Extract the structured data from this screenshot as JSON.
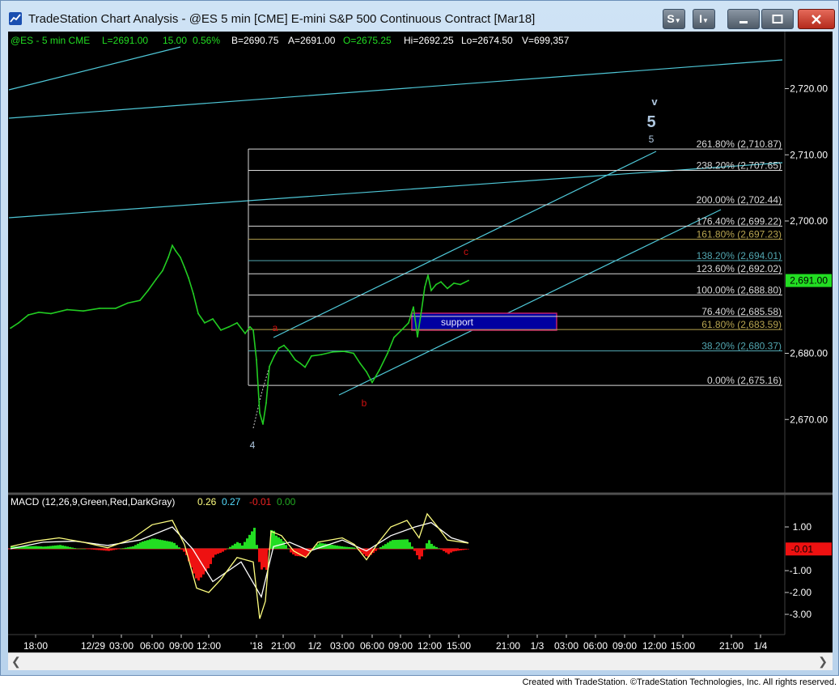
{
  "window": {
    "title": "TradeStation Chart Analysis - @ES 5 min [CME] E-mini S&P 500 Continuous Contract [Mar18]",
    "buttons": {
      "s_menu": "S",
      "i_menu": "I"
    }
  },
  "symbol_bar": {
    "symbol": "@ES - 5 min  CME",
    "last": "L=2691.00",
    "change": "15.00",
    "pct": "0.56%",
    "bid": "B=2690.75",
    "ask": "A=2691.00",
    "open": "O=2675.25",
    "high": "Hi=2692.25",
    "low": "Lo=2674.50",
    "volume": "V=699,357"
  },
  "price_axis": {
    "ticks": [
      "2,720.00",
      "2,710.00",
      "2,700.00",
      "2,680.00",
      "2,670.00"
    ],
    "tick_values": [
      2720,
      2710,
      2700,
      2680,
      2670
    ],
    "last_label": "2,691.00",
    "last_value": 2691
  },
  "fib_levels": [
    {
      "label": "261.80% (2,710.87)",
      "value": 2710.87,
      "color": "#d9d9d9"
    },
    {
      "label": "238.20% (2,707.65)",
      "value": 2707.65,
      "color": "#d9d9d9"
    },
    {
      "label": "200.00% (2,702.44)",
      "value": 2702.44,
      "color": "#d9d9d9"
    },
    {
      "label": "176.40% (2,699.22)",
      "value": 2699.22,
      "color": "#d9d9d9"
    },
    {
      "label": "161.80% (2,697.23)",
      "value": 2697.23,
      "color": "#b8a550"
    },
    {
      "label": "138.20% (2,694.01)",
      "value": 2694.01,
      "color": "#52a6b0"
    },
    {
      "label": "123.60% (2,692.02)",
      "value": 2692.02,
      "color": "#d9d9d9"
    },
    {
      "label": "100.00% (2,688.80)",
      "value": 2688.8,
      "color": "#d9d9d9"
    },
    {
      "label": "76.40% (2,685.58)",
      "value": 2685.58,
      "color": "#d9d9d9"
    },
    {
      "label": "61.80% (2,683.59)",
      "value": 2683.59,
      "color": "#b8a550"
    },
    {
      "label": "38.20% (2,680.37)",
      "value": 2680.37,
      "color": "#52a6b0"
    },
    {
      "label": "0.00% (2,675.16)",
      "value": 2675.16,
      "color": "#d9d9d9"
    }
  ],
  "wave_labels": {
    "v_small": "v",
    "five_big": "5",
    "five_small": "5",
    "a": "a",
    "b": "b",
    "c": "c",
    "four": "4",
    "support": "support"
  },
  "macd": {
    "title": "MACD (12,26,9,Green,Red,DarkGray)",
    "v1": "0.26",
    "v2": "0.27",
    "v3": "-0.01",
    "v4": "0.00",
    "ticks": [
      "1.00",
      "-1.00",
      "-2.00",
      "-3.00"
    ],
    "tick_values": [
      1,
      -1,
      -2,
      -3
    ],
    "last_label": "-0.01",
    "last_value": -0.01
  },
  "time_axis": {
    "labels": [
      "18:00",
      "12/29",
      "03:00",
      "06:00",
      "09:00",
      "12:00",
      "'18",
      "21:00",
      "1/2",
      "03:00",
      "06:00",
      "09:00",
      "12:00",
      "15:00",
      "21:00",
      "1/3",
      "03:00",
      "06:00",
      "09:00",
      "12:00",
      "15:00",
      "21:00",
      "1/4"
    ]
  },
  "colors": {
    "price": "#22cc22",
    "trend_lines": "#4fc8d8",
    "fib_lines": "#e0e0e0",
    "wave_red": "#d01010",
    "wave_blue": "#b0c8e0",
    "support_box": "#0000a0",
    "macd_line": "#ffff80",
    "signal_line": "#ffffff",
    "hist_pos": "#22dd22",
    "hist_neg": "#ee1111"
  },
  "footer": {
    "credit": "Created with TradeStation. ©TradeStation Technologies, Inc. All rights reserved."
  },
  "chart_data": {
    "type": "line",
    "title": "@ES 5 min [CME] E-mini S&P 500 Continuous Contract [Mar18]",
    "xlabel": "",
    "ylabel": "",
    "ylim": [
      2660,
      2727
    ],
    "grid": false,
    "price_path": [
      {
        "t": 0,
        "v": 2683.8
      },
      {
        "t": 10,
        "v": 2684.6
      },
      {
        "t": 22,
        "v": 2685.8
      },
      {
        "t": 35,
        "v": 2686.2
      },
      {
        "t": 50,
        "v": 2686.0
      },
      {
        "t": 70,
        "v": 2686.6
      },
      {
        "t": 90,
        "v": 2686.4
      },
      {
        "t": 110,
        "v": 2686.8
      },
      {
        "t": 130,
        "v": 2686.8
      },
      {
        "t": 145,
        "v": 2687.6
      },
      {
        "t": 160,
        "v": 2688.0
      },
      {
        "t": 170,
        "v": 2689.5
      },
      {
        "t": 180,
        "v": 2691.2
      },
      {
        "t": 188,
        "v": 2692.5
      },
      {
        "t": 195,
        "v": 2694.5
      },
      {
        "t": 200,
        "v": 2696.3
      },
      {
        "t": 204,
        "v": 2695.5
      },
      {
        "t": 210,
        "v": 2694.5
      },
      {
        "t": 215,
        "v": 2693.0
      },
      {
        "t": 220,
        "v": 2691.4
      },
      {
        "t": 226,
        "v": 2689.0
      },
      {
        "t": 232,
        "v": 2686.0
      },
      {
        "t": 240,
        "v": 2684.6
      },
      {
        "t": 250,
        "v": 2685.2
      },
      {
        "t": 260,
        "v": 2683.5
      },
      {
        "t": 270,
        "v": 2684.0
      },
      {
        "t": 280,
        "v": 2684.6
      },
      {
        "t": 290,
        "v": 2683.0
      },
      {
        "t": 296,
        "v": 2684.0
      },
      {
        "t": 300,
        "v": 2683.5
      },
      {
        "t": 304,
        "v": 2679.0
      },
      {
        "t": 308,
        "v": 2671.0
      },
      {
        "t": 312,
        "v": 2669.3
      },
      {
        "t": 316,
        "v": 2672.5
      },
      {
        "t": 320,
        "v": 2678.0
      },
      {
        "t": 326,
        "v": 2679.6
      },
      {
        "t": 332,
        "v": 2680.8
      },
      {
        "t": 338,
        "v": 2681.2
      },
      {
        "t": 344,
        "v": 2680.4
      },
      {
        "t": 352,
        "v": 2679.0
      },
      {
        "t": 358,
        "v": 2678.5
      },
      {
        "t": 364,
        "v": 2677.9
      },
      {
        "t": 372,
        "v": 2679.6
      },
      {
        "t": 384,
        "v": 2679.8
      },
      {
        "t": 398,
        "v": 2680.2
      },
      {
        "t": 412,
        "v": 2680.3
      },
      {
        "t": 424,
        "v": 2680.0
      },
      {
        "t": 432,
        "v": 2678.5
      },
      {
        "t": 440,
        "v": 2677.2
      },
      {
        "t": 447,
        "v": 2675.6
      },
      {
        "t": 456,
        "v": 2677.5
      },
      {
        "t": 466,
        "v": 2680.0
      },
      {
        "t": 474,
        "v": 2682.4
      },
      {
        "t": 484,
        "v": 2683.6
      },
      {
        "t": 492,
        "v": 2684.6
      },
      {
        "t": 498,
        "v": 2687.0
      },
      {
        "t": 503,
        "v": 2682.5
      },
      {
        "t": 508,
        "v": 2686.5
      },
      {
        "t": 512,
        "v": 2690.0
      },
      {
        "t": 516,
        "v": 2691.8
      },
      {
        "t": 520,
        "v": 2689.5
      },
      {
        "t": 526,
        "v": 2690.4
      },
      {
        "t": 532,
        "v": 2690.8
      },
      {
        "t": 540,
        "v": 2689.8
      },
      {
        "t": 548,
        "v": 2690.6
      },
      {
        "t": 556,
        "v": 2690.4
      },
      {
        "t": 566,
        "v": 2691.0
      }
    ],
    "series": [
      {
        "name": "MACD",
        "values": [
          {
            "t": 0,
            "v": 0.1
          },
          {
            "t": 30,
            "v": 0.35
          },
          {
            "t": 60,
            "v": 0.5
          },
          {
            "t": 90,
            "v": 0.3
          },
          {
            "t": 120,
            "v": 0.05
          },
          {
            "t": 150,
            "v": 0.45
          },
          {
            "t": 175,
            "v": 1.1
          },
          {
            "t": 200,
            "v": 1.3
          },
          {
            "t": 215,
            "v": 0.2
          },
          {
            "t": 230,
            "v": -1.8
          },
          {
            "t": 245,
            "v": -2.0
          },
          {
            "t": 260,
            "v": -1.4
          },
          {
            "t": 280,
            "v": -0.4
          },
          {
            "t": 300,
            "v": -0.6
          },
          {
            "t": 308,
            "v": -3.2
          },
          {
            "t": 315,
            "v": -2.4
          },
          {
            "t": 322,
            "v": 0.8
          },
          {
            "t": 335,
            "v": 0.6
          },
          {
            "t": 350,
            "v": -0.1
          },
          {
            "t": 365,
            "v": -0.4
          },
          {
            "t": 380,
            "v": 0.3
          },
          {
            "t": 410,
            "v": 0.5
          },
          {
            "t": 425,
            "v": 0.2
          },
          {
            "t": 440,
            "v": -0.5
          },
          {
            "t": 455,
            "v": 0.3
          },
          {
            "t": 470,
            "v": 1.0
          },
          {
            "t": 490,
            "v": 1.3
          },
          {
            "t": 505,
            "v": 0.5
          },
          {
            "t": 515,
            "v": 1.6
          },
          {
            "t": 528,
            "v": 1.0
          },
          {
            "t": 540,
            "v": 0.4
          },
          {
            "t": 566,
            "v": 0.26
          }
        ]
      },
      {
        "name": "MACDAvg",
        "values": [
          {
            "t": 0,
            "v": 0.0
          },
          {
            "t": 40,
            "v": 0.3
          },
          {
            "t": 80,
            "v": 0.35
          },
          {
            "t": 120,
            "v": 0.15
          },
          {
            "t": 160,
            "v": 0.4
          },
          {
            "t": 200,
            "v": 1.0
          },
          {
            "t": 225,
            "v": 0.0
          },
          {
            "t": 250,
            "v": -1.5
          },
          {
            "t": 285,
            "v": -0.6
          },
          {
            "t": 310,
            "v": -2.2
          },
          {
            "t": 325,
            "v": 0.1
          },
          {
            "t": 345,
            "v": 0.3
          },
          {
            "t": 370,
            "v": -0.1
          },
          {
            "t": 410,
            "v": 0.4
          },
          {
            "t": 440,
            "v": -0.1
          },
          {
            "t": 470,
            "v": 0.6
          },
          {
            "t": 500,
            "v": 1.0
          },
          {
            "t": 520,
            "v": 1.2
          },
          {
            "t": 545,
            "v": 0.5
          },
          {
            "t": 566,
            "v": 0.27
          }
        ]
      }
    ]
  }
}
